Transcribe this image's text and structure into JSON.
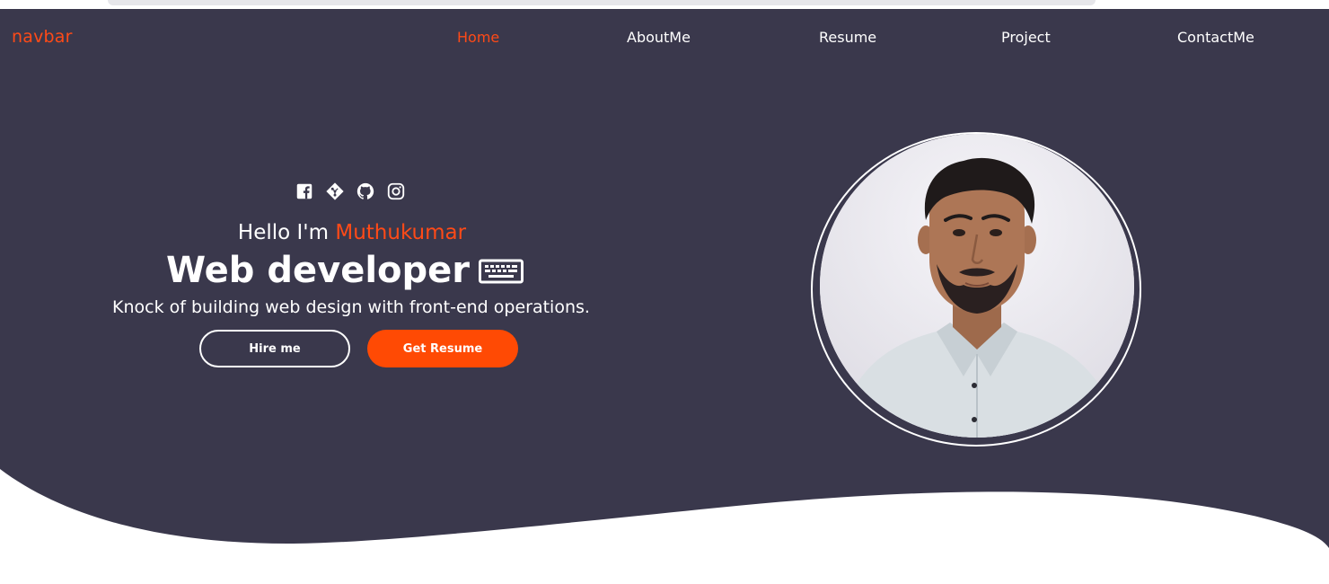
{
  "navbar": {
    "brand": "navbar",
    "items": [
      {
        "label": "Home",
        "active": true
      },
      {
        "label": "AboutMe",
        "active": false
      },
      {
        "label": "Resume",
        "active": false
      },
      {
        "label": "Project",
        "active": false
      },
      {
        "label": "ContactMe",
        "active": false
      }
    ]
  },
  "hero": {
    "social_icons": [
      "facebook-icon",
      "git-icon",
      "github-icon",
      "instagram-icon"
    ],
    "greeting_prefix": "Hello I'm ",
    "name": "Muthukumar",
    "role": "Web developer",
    "role_icon": "keyboard-icon",
    "tagline": "Knock of building web design with front-end operations.",
    "buttons": {
      "hire": "Hire me",
      "resume": "Get Resume"
    }
  },
  "colors": {
    "background": "#3a384c",
    "accent": "#ff4a17",
    "button": "#ff4a04",
    "text": "#ffffff"
  }
}
